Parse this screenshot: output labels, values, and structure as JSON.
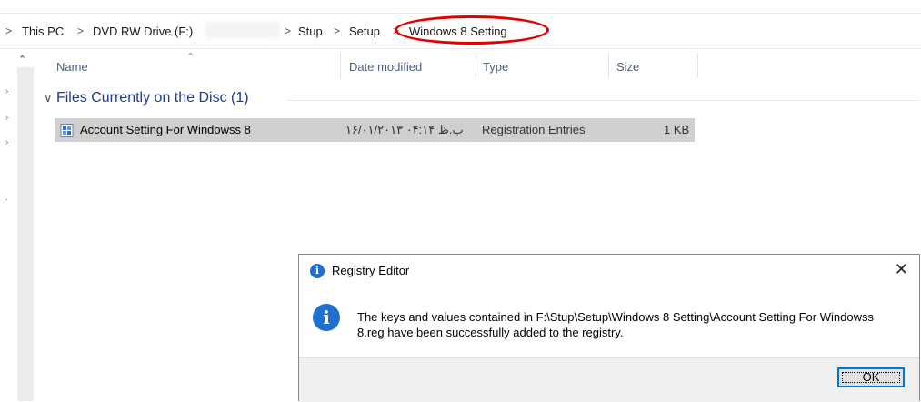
{
  "breadcrumb": {
    "items": [
      "This PC",
      "DVD RW Drive (F:)",
      "Stup",
      "Setup",
      "Windows 8 Setting"
    ],
    "separator": ">"
  },
  "columns": {
    "name": "Name",
    "date_modified": "Date modified",
    "type": "Type",
    "size": "Size"
  },
  "group": {
    "label": "Files Currently on the Disc (1)"
  },
  "files": [
    {
      "name": "Account Setting For Windowss 8",
      "date_modified": "۱۶/۰۱/۲۰۱۳ ب.ظ ۰۴:۱۴",
      "type": "Registration Entries",
      "size": "1 KB"
    }
  ],
  "dialog": {
    "title": "Registry Editor",
    "message": "The keys and values contained in F:\\Stup\\Setup\\Windows 8 Setting\\Account Setting For Windowss 8.reg have been successfully added to the registry.",
    "ok_label": "OK",
    "close_glyph": "✕",
    "info_glyph": "i"
  },
  "colors": {
    "highlight": "#e00000",
    "accent": "#0078d7",
    "group_text": "#1e3a8a"
  }
}
